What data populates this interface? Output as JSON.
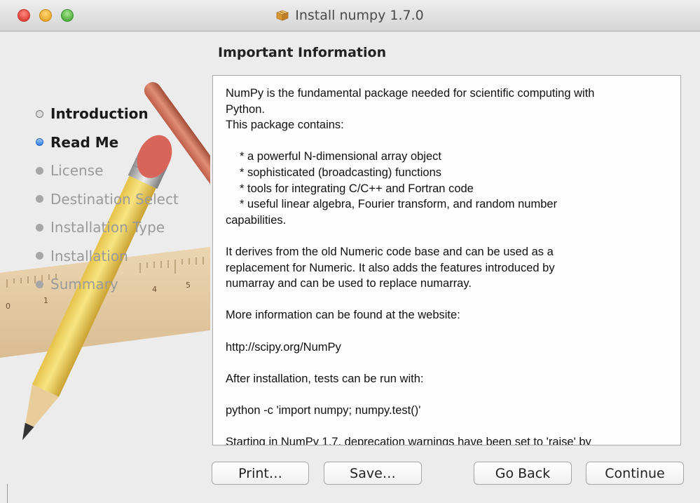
{
  "window": {
    "title": "Install numpy 1.7.0",
    "title_icon": "package-box-icon"
  },
  "sidebar": {
    "steps": [
      {
        "label": "Introduction",
        "state": "done"
      },
      {
        "label": "Read Me",
        "state": "current"
      },
      {
        "label": "License",
        "state": "pending"
      },
      {
        "label": "Destination Select",
        "state": "pending"
      },
      {
        "label": "Installation Type",
        "state": "pending"
      },
      {
        "label": "Installation",
        "state": "pending"
      },
      {
        "label": "Summary",
        "state": "pending"
      }
    ]
  },
  "main": {
    "heading": "Important Information",
    "readme": {
      "intro_1": "NumPy is the fundamental package needed for scientific computing with",
      "intro_2": "Python.",
      "intro_3": "This package contains:",
      "features": [
        "* a powerful N-dimensional array object",
        "* sophisticated (broadcasting) functions",
        "* tools for integrating C/C++ and Fortran code",
        "* useful linear algebra, Fourier transform, and random number"
      ],
      "features_tail": "capabilities.",
      "derives_1": "It derives from the old Numeric code base and can be used as a",
      "derives_2": "replacement for Numeric. It also adds the features introduced by",
      "derives_3": "numarray and can be used to replace numarray.",
      "more_info": "More information can be found at the website:",
      "url": "http://scipy.org/NumPy",
      "after_install": "After installation, tests can be run with:",
      "test_command": "python -c 'import numpy; numpy.test()'",
      "starting": "Starting in NumPy 1.7, deprecation warnings have been set to 'raise' by"
    }
  },
  "buttons": {
    "print": "Print…",
    "save": "Save…",
    "go_back": "Go Back",
    "continue": "Continue"
  },
  "ruler": {
    "ticks": [
      "0",
      "1",
      "4",
      "5"
    ]
  },
  "colors": {
    "current_bullet": "#2f7de8",
    "close": "#e0443a",
    "minimize": "#e7a92a",
    "zoom": "#52b042"
  }
}
